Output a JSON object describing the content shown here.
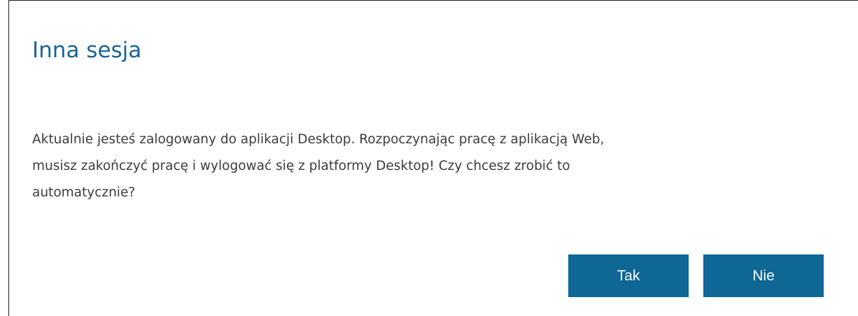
{
  "dialog": {
    "title": "Inna sesja",
    "message_lines": [
      "Aktualnie jesteś zalogowany do aplikacji Desktop. Rozpoczynając pracę z aplikacją Web,",
      "musisz zakończyć pracę i wylogować się z platformy Desktop! Czy chcesz zrobić to",
      "automatycznie?"
    ],
    "yes_label": "Tak",
    "no_label": "Nie"
  },
  "colors": {
    "title": "#1a6496",
    "button_background": "#0e6795",
    "button_text": "#ffffff",
    "message_text": "#3c3c3c"
  }
}
